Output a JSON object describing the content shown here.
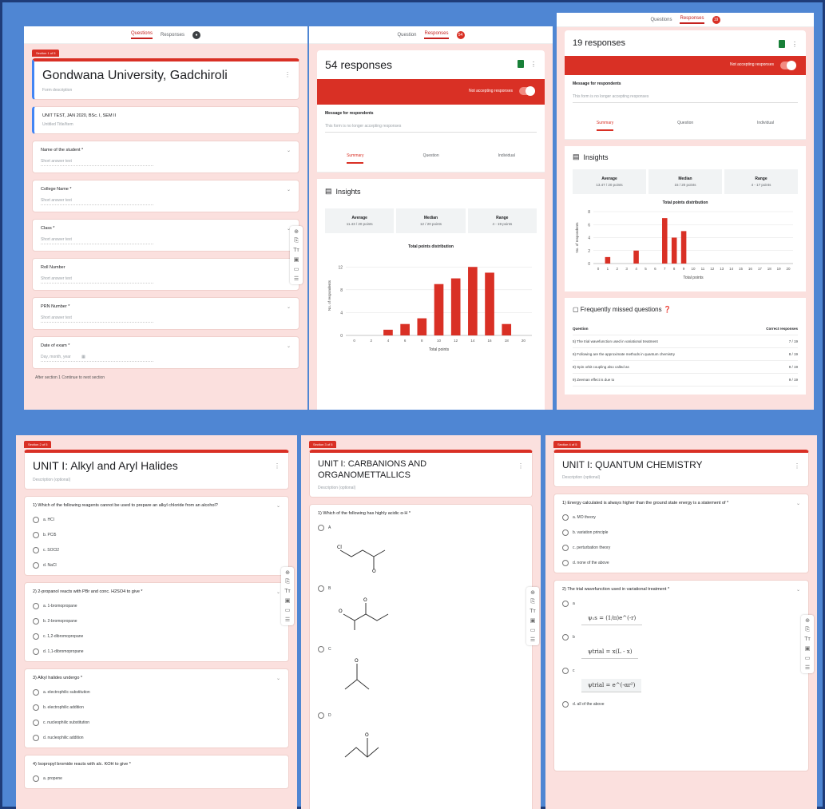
{
  "colors": {
    "frame_blue": "#4f86d3",
    "form_red": "#d93025",
    "panel_pink": "#fbe0de"
  },
  "top_left": {
    "tabs": [
      "Questions",
      "Responses"
    ],
    "section_tag": "Section 1 of 5",
    "title": "Gondwana University, Gadchiroli",
    "description": "Form description",
    "intro": "UNIT TEST, JAN 2020, BSc. I, SEM II",
    "intro_sub": "Untitled Title/Item",
    "questions": [
      {
        "label": "Name of the student *",
        "hint": "Short answer text"
      },
      {
        "label": "College Name *",
        "hint": "Short answer text"
      },
      {
        "label": "Class *",
        "hint": "Short answer text"
      },
      {
        "label": "Roll Number",
        "hint": "Short answer text"
      },
      {
        "label": "PRN Number *",
        "hint": "Short answer text"
      },
      {
        "label": "Date of exam *",
        "hint": "Day, month, year"
      }
    ],
    "after_section": "After section 1   Continue to next section"
  },
  "top_mid": {
    "tabs": [
      "Question",
      "Responses"
    ],
    "responses_badge": "54",
    "responses": "54 responses",
    "accepting": "Not accepting responses",
    "msg_title": "Message for respondents",
    "msg_text": "This form is no longer accepting responses",
    "rtabs": [
      "Summary",
      "Question",
      "Individual"
    ],
    "insights": "Insights",
    "stats": [
      {
        "label": "Average",
        "value": "11.43 / 20 points"
      },
      {
        "label": "Median",
        "value": "12 / 20 points"
      },
      {
        "label": "Range",
        "value": "4 - 19 points"
      }
    ],
    "dist_title": "Total points distribution",
    "xlabel": "Total points",
    "ylabel": "No. of respondents"
  },
  "top_right": {
    "tabs": [
      "Questions",
      "Responses"
    ],
    "responses_badge": "19",
    "responses": "19 responses",
    "accepting": "Not accepting responses",
    "msg_title": "Message for respondents",
    "msg_text": "This form is no longer accepting responses",
    "rtabs": [
      "Summary",
      "Question",
      "Individual"
    ],
    "insights": "Insights",
    "stats": [
      {
        "label": "Average",
        "value": "13.47 / 20 points"
      },
      {
        "label": "Median",
        "value": "15 / 20 points"
      },
      {
        "label": "Range",
        "value": "4 - 17 points"
      }
    ],
    "dist_title": "Total points distribution",
    "xlabel": "Total points",
    "ylabel": "No. of respondents",
    "missed_title": "Frequently missed questions",
    "missed_head": [
      "Question",
      "Correct responses"
    ],
    "missed_rows": [
      {
        "q": "5) The trial wavefunction used in variational treatment",
        "c": "7 / 19"
      },
      {
        "q": "6) Following are the approximate methods in quantum chemistry",
        "c": "8 / 19"
      },
      {
        "q": "8) Spin orbit coupling also called as",
        "c": "9 / 19"
      },
      {
        "q": "9) Zeeman effect is due to",
        "c": "9 / 19"
      }
    ]
  },
  "chart_data": [
    {
      "type": "bar",
      "title": "Total points distribution",
      "xlabel": "Total points",
      "ylabel": "No. of respondents",
      "x": [
        0,
        2,
        4,
        6,
        8,
        10,
        12,
        14,
        16,
        18,
        20
      ],
      "values": [
        0,
        0,
        1,
        2,
        3,
        9,
        10,
        12,
        11,
        2,
        0
      ],
      "ylim": [
        0,
        14
      ],
      "ytick_labels": [
        "0",
        "4",
        "8",
        "12"
      ]
    },
    {
      "type": "bar",
      "title": "Total points distribution",
      "xlabel": "Total points",
      "ylabel": "No. of respondents",
      "x": [
        0,
        1,
        2,
        3,
        4,
        5,
        6,
        7,
        8,
        9,
        10,
        11,
        12,
        13,
        14,
        15,
        16,
        17,
        18,
        19,
        20
      ],
      "values": [
        0,
        1,
        0,
        0,
        2,
        0,
        0,
        7,
        4,
        5,
        0,
        0,
        0,
        0,
        0,
        0,
        0,
        0,
        0,
        0,
        0
      ],
      "ylim": [
        0,
        8
      ],
      "ytick_labels": [
        "0",
        "2",
        "4",
        "6",
        "8"
      ]
    }
  ],
  "bottom_left": {
    "section_tag": "Section 2 of 5",
    "title": "UNIT I: Alkyl and Aryl Halides",
    "description": "Description (optional)",
    "questions": [
      {
        "label": "1) Which of the following reagents cannot be used to prepare an alkyl chloride from an alcohol?",
        "options": [
          "a. HCl",
          "b. PCl5",
          "c. SOCl2",
          "d. NaCl"
        ]
      },
      {
        "label": "2) 2-propanol reacts with PBr and conc. H2SO4 to give *",
        "options": [
          "a. 1-bromopropane",
          "b. 2-bromopropane",
          "c. 1,2-dibromopropane",
          "d. 1,1-dibromopropane"
        ]
      },
      {
        "label": "3) Alkyl halides undergo *",
        "options": [
          "a. electrophilic substitution",
          "b. electrophilic addition",
          "c. nucleophilic substitution",
          "d. nucleophilic addition"
        ]
      },
      {
        "label": "4) Isopropyl bromide reacts with alc. KOH to give *",
        "options": [
          "a. propene"
        ]
      }
    ]
  },
  "bottom_mid": {
    "section_tag": "Section 3 of 5",
    "title": "UNIT I: CARBANIONS AND ORGANOMETTALLICS",
    "description": "Description (optional)",
    "question": "1) Which of the following has highly acidic α-H *",
    "options": [
      "A",
      "B",
      "C",
      "D"
    ]
  },
  "bottom_right": {
    "section_tag": "Section 4 of 5",
    "title": "UNIT I: QUANTUM CHEMISTRY",
    "description": "Description (optional)",
    "q1": "1) Energy calculated is always higher than the ground state energy is a statement of *",
    "q1_options": [
      "a. MO theory",
      "b. variation principle",
      "c. perturbation theory",
      "d. none of the above"
    ],
    "q2": "2) The trial wavefunction used in variational treatment *",
    "q2_options": [
      "a",
      "b",
      "c",
      "d. all of the above"
    ],
    "formulas": [
      "ψ₁s = (1/π)e^(-r)",
      "ψtrial = x(L - x)",
      "ψtrial = e^(-αr²)"
    ]
  }
}
